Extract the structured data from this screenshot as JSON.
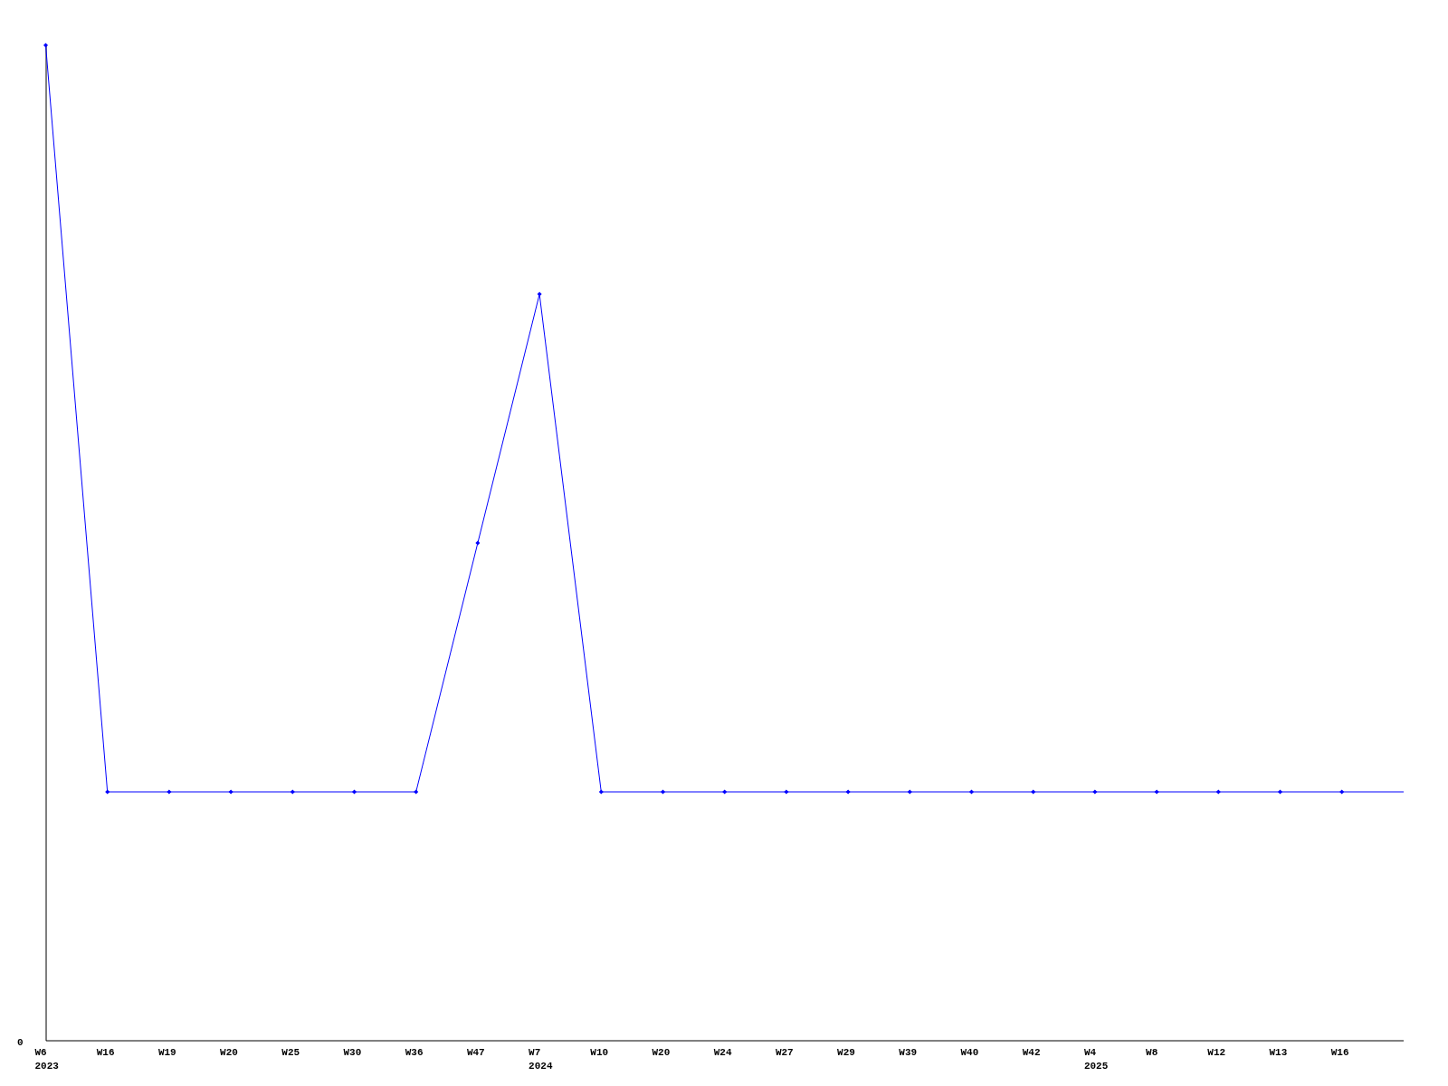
{
  "chart": {
    "y_tick": "0",
    "x_ticks": [
      {
        "label": "W6",
        "year": "2023"
      },
      {
        "label": "W16"
      },
      {
        "label": "W19"
      },
      {
        "label": "W20"
      },
      {
        "label": "W25"
      },
      {
        "label": "W30"
      },
      {
        "label": "W36"
      },
      {
        "label": "W47"
      },
      {
        "label": "W7",
        "year": "2024"
      },
      {
        "label": "W10"
      },
      {
        "label": "W20"
      },
      {
        "label": "W24"
      },
      {
        "label": "W27"
      },
      {
        "label": "W29"
      },
      {
        "label": "W39"
      },
      {
        "label": "W40"
      },
      {
        "label": "W42"
      },
      {
        "label": "W4",
        "year": "2025"
      },
      {
        "label": "W8"
      },
      {
        "label": "W12"
      },
      {
        "label": "W13"
      },
      {
        "label": "W16"
      }
    ]
  }
}
